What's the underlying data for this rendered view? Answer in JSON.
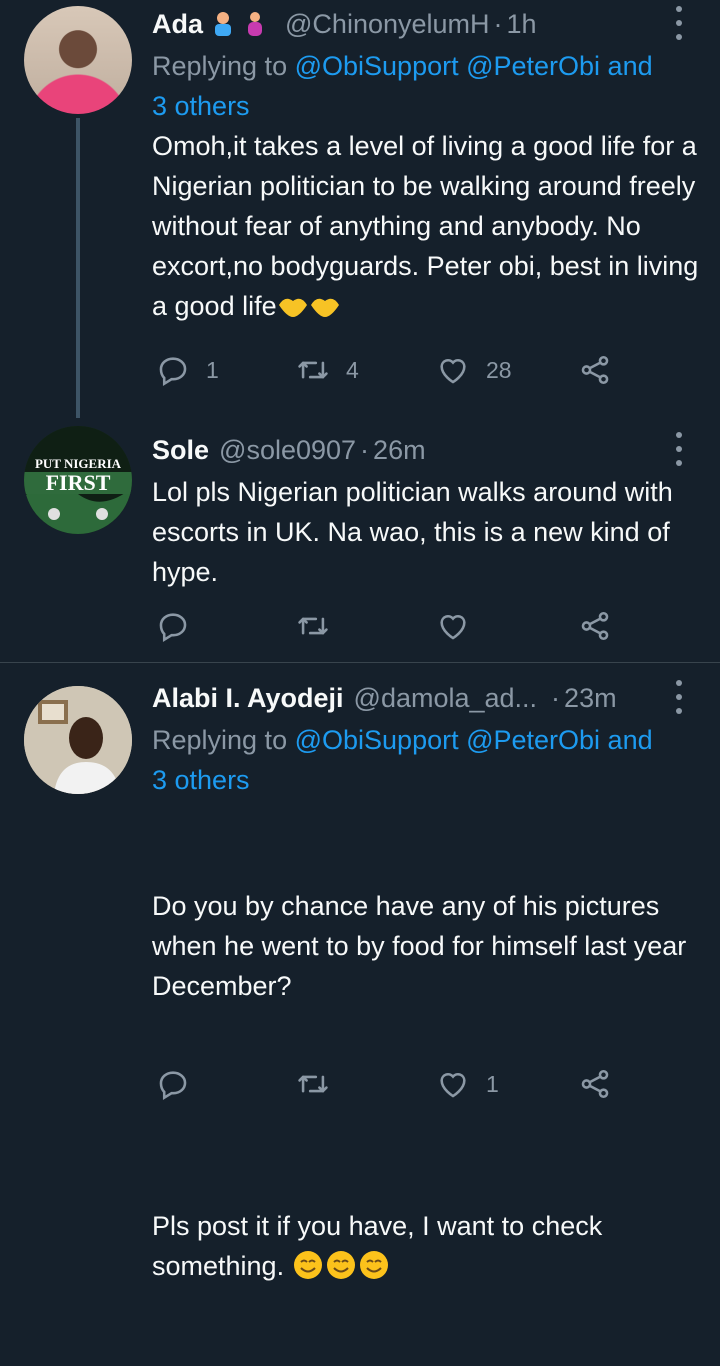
{
  "tweets": [
    {
      "name": "Ada",
      "handle": "@ChinonyelumH",
      "separator": "·",
      "time": "1h",
      "replying_prefix": "Replying to",
      "replying_mentions": "@ObiSupport @PeterObi and",
      "replying_others": "3 others",
      "text": "Omoh,it takes a level of living a good life for a Nigerian politician to be walking around freely without fear of anything and anybody. No excort,no bodyguards. Peter obi, best in living a good life",
      "reply_count": "1",
      "retweet_count": "4",
      "like_count": "28"
    },
    {
      "name": "Sole",
      "handle": "@sole0907",
      "separator": "·",
      "time": "26m",
      "text": "Lol pls Nigerian politician walks around with escorts in UK. Na wao, this is a new kind of hype.",
      "avatar_text_top": "PUT NIGERIA",
      "avatar_text_main": "FIRST"
    },
    {
      "name": "Alabi I. Ayodeji",
      "handle": "@damola_ad...",
      "separator": "·",
      "time": "23m",
      "replying_prefix": "Replying to",
      "replying_mentions": "@ObiSupport @PeterObi and",
      "replying_others": "3 others",
      "text_p1": "Do you by chance have any of his pictures when he went to by food for himself last year December?",
      "text_p2": "Pls post it if you have, I want to check something.",
      "like_count": "1"
    }
  ],
  "colors": {
    "background": "#15202b",
    "text": "#f7f9f9",
    "muted": "#8b98a5",
    "accent": "#1d9bf0",
    "divider": "#38444d"
  },
  "icons": [
    "reply-icon",
    "retweet-icon",
    "like-icon",
    "share-icon",
    "more-icon"
  ]
}
